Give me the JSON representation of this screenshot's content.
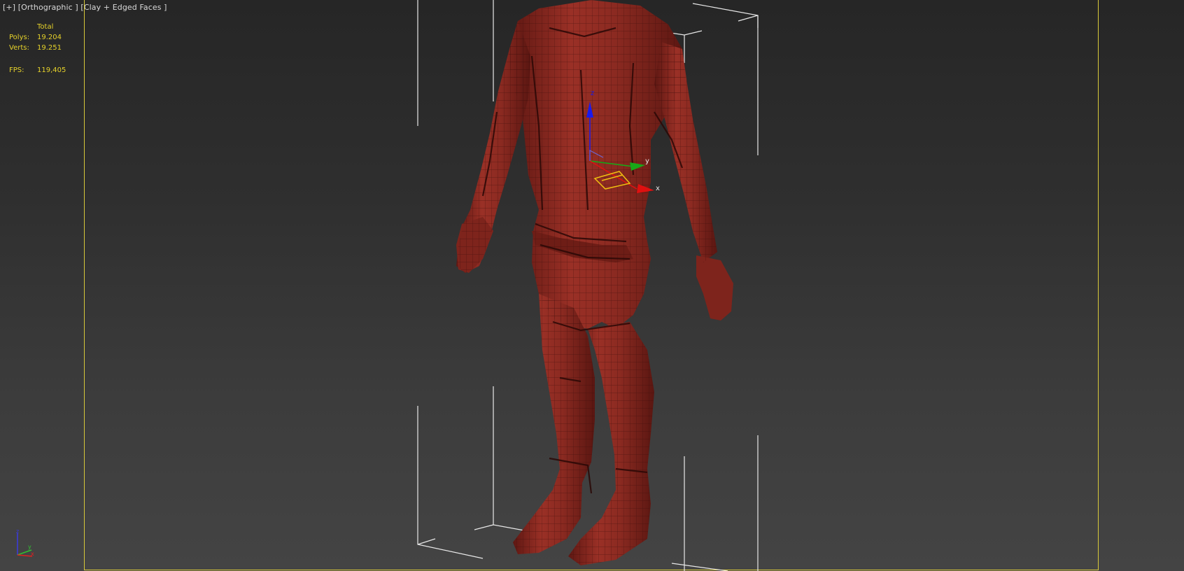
{
  "viewport": {
    "menu_plus": "[+]",
    "view_name": "[Orthographic ]",
    "shading_mode": "[Clay + Edged Faces ]"
  },
  "stats": {
    "header": "Total",
    "polys_label": "Polys:",
    "polys_value": "19.204",
    "verts_label": "Verts:",
    "verts_value": "19.251",
    "fps_label": "FPS:",
    "fps_value": "119,405"
  },
  "gizmo": {
    "x": "x",
    "y": "y",
    "z": "z"
  },
  "tripod": {
    "x": "x",
    "y": "y",
    "z": "z"
  },
  "colors": {
    "model": "#8e2a22",
    "stats_text": "#e6d22a",
    "safe_frame": "#d8c93a",
    "axis_x": "#e01010",
    "axis_y": "#18a818",
    "axis_z": "#1a1aee"
  }
}
